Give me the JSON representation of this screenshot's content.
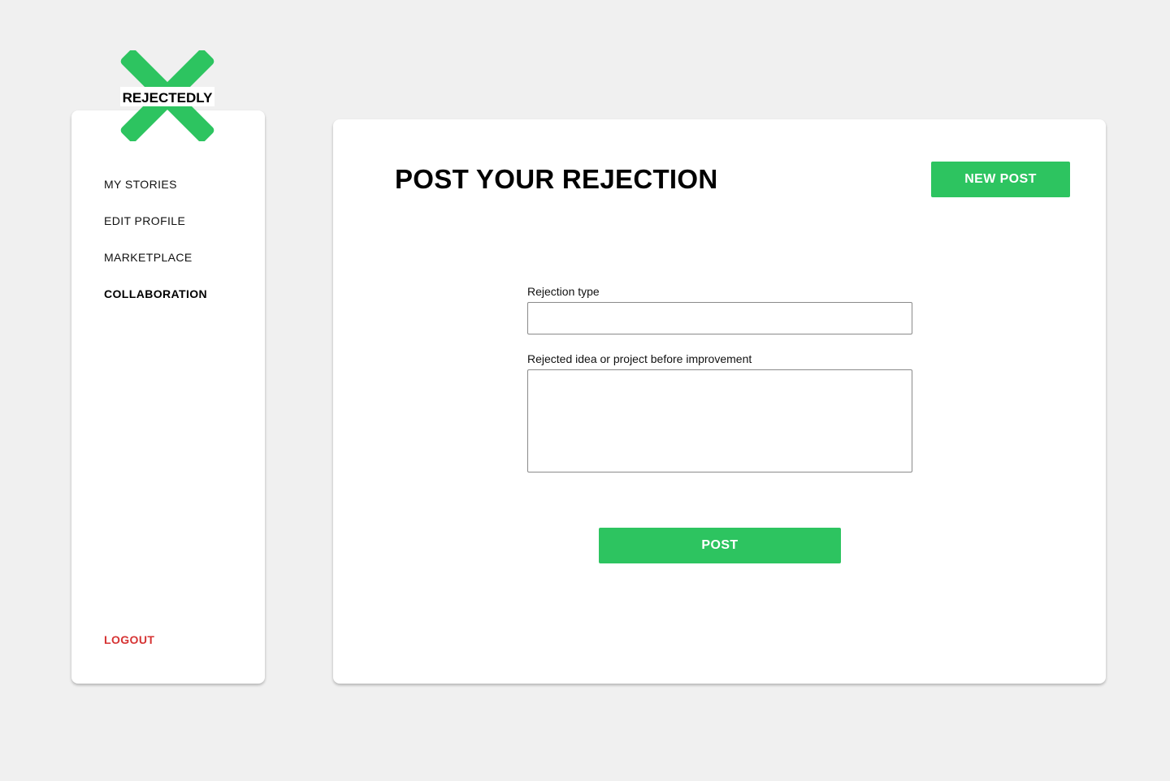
{
  "colors": {
    "background": "#f0f0f0",
    "card": "#ffffff",
    "accent_green": "#2dc460",
    "logout_red": "#d63333",
    "text": "#111111"
  },
  "logo": {
    "text": "REJECTEDLY",
    "icon": "x-mark-icon"
  },
  "sidebar": {
    "items": [
      {
        "label": "MY STORIES",
        "active": false
      },
      {
        "label": "EDIT PROFILE",
        "active": false
      },
      {
        "label": "MARKETPLACE",
        "active": false
      },
      {
        "label": "COLLABORATION",
        "active": true
      }
    ],
    "logout_label": "LOGOUT"
  },
  "main": {
    "title": "POST YOUR REJECTION",
    "new_post_label": "NEW POST",
    "form": {
      "rejection_type_label": "Rejection type",
      "rejection_type_value": "",
      "idea_label": "Rejected idea or project before improvement",
      "idea_value": ""
    },
    "post_label": "POST"
  }
}
